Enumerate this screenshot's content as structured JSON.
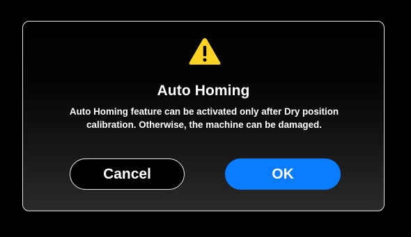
{
  "dialog": {
    "icon": "warning-triangle-icon",
    "title": "Auto Homing",
    "message": "Auto Homing feature can be activated only after Dry position calibration. Otherwise, the machine can be damaged.",
    "cancel_label": "Cancel",
    "ok_label": "OK"
  },
  "colors": {
    "warning_yellow": "#fed325",
    "primary_button": "#0a7cff",
    "border": "#e6e6e6"
  }
}
